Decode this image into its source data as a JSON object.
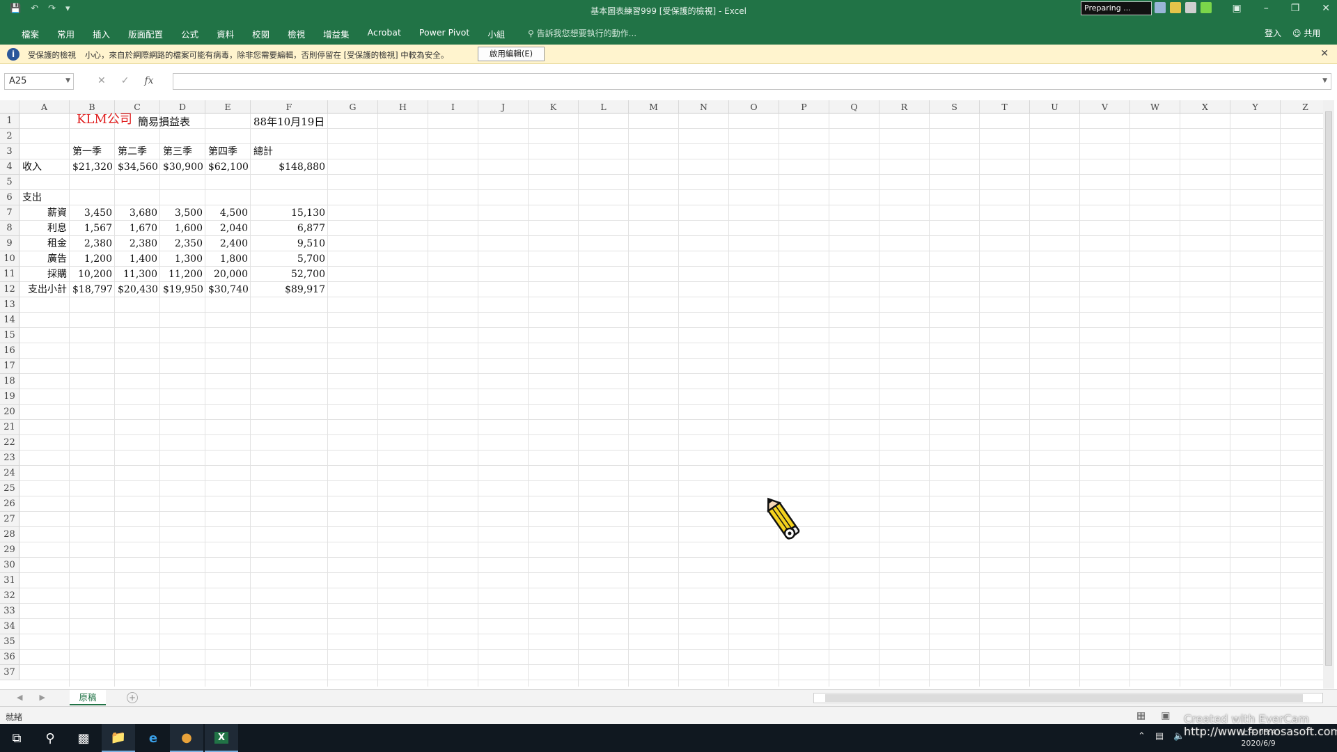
{
  "titlebar": {
    "title": "基本圖表練習999 [受保護的檢視] - Excel",
    "preparing": "Preparing ..."
  },
  "ribbon": {
    "tabs": [
      "檔案",
      "常用",
      "插入",
      "版面配置",
      "公式",
      "資料",
      "校閱",
      "檢視",
      "增益集",
      "Acrobat",
      "Power Pivot",
      "小組"
    ],
    "tell_me": "告訴我您想要執行的動作...",
    "sign_in": "登入",
    "share": "共用"
  },
  "message_bar": {
    "title": "受保護的檢視",
    "text": "小心，來自於網際網路的檔案可能有病毒，除非您需要編輯，否則停留在 [受保護的檢視] 中較為安全。",
    "enable_button": "啟用編輯(E)"
  },
  "formula_bar": {
    "name_box": "A25",
    "fx": "fx",
    "value": ""
  },
  "columns": [
    "A",
    "B",
    "C",
    "D",
    "E",
    "F",
    "G",
    "H",
    "I",
    "J",
    "K",
    "L",
    "M",
    "N",
    "O",
    "P",
    "Q",
    "R",
    "S",
    "T",
    "U",
    "V",
    "W",
    "X",
    "Y",
    "Z"
  ],
  "rows": [
    "1",
    "2",
    "3",
    "4",
    "5",
    "6",
    "7",
    "8",
    "9",
    "10",
    "11",
    "12",
    "13",
    "14",
    "15",
    "16",
    "17",
    "18",
    "19",
    "20",
    "21",
    "22",
    "23",
    "24",
    "25",
    "26",
    "27",
    "28",
    "29",
    "30",
    "31",
    "32",
    "33",
    "34",
    "35",
    "36",
    "37"
  ],
  "sheet": {
    "title_red": "KLM公司",
    "title_rest": "簡易損益表",
    "date": "88年10月19日",
    "headers": [
      "第一季",
      "第二季",
      "第三季",
      "第四季",
      "總計"
    ],
    "income_label": "收入",
    "income": [
      "$21,320",
      "$34,560",
      "$30,900",
      "$62,100",
      "$148,880"
    ],
    "expense_label": "支出",
    "expenses": [
      {
        "label": "薪資",
        "values": [
          "3,450",
          "3,680",
          "3,500",
          "4,500",
          "15,130"
        ]
      },
      {
        "label": "利息",
        "values": [
          "1,567",
          "1,670",
          "1,600",
          "2,040",
          "6,877"
        ]
      },
      {
        "label": "租金",
        "values": [
          "2,380",
          "2,380",
          "2,350",
          "2,400",
          "9,510"
        ]
      },
      {
        "label": "廣告",
        "values": [
          "1,200",
          "1,400",
          "1,300",
          "1,800",
          "5,700"
        ]
      },
      {
        "label": "採購",
        "values": [
          "10,200",
          "11,300",
          "11,200",
          "20,000",
          "52,700"
        ]
      }
    ],
    "subtotal_label": "支出小計",
    "subtotal": [
      "$18,797",
      "$20,430",
      "$19,950",
      "$30,740",
      "$89,917"
    ]
  },
  "sheet_tab": "原稿",
  "status": "就緒",
  "watermark": {
    "line1": "Created with EverCam",
    "line2": "http://www.formosasoft.com"
  },
  "clock": {
    "time": "上午 06:4",
    "date": "2020/6/9"
  },
  "colors": {
    "excel_green": "#217346",
    "title_red": "#e02020",
    "message_bar": "#fff4ce"
  }
}
